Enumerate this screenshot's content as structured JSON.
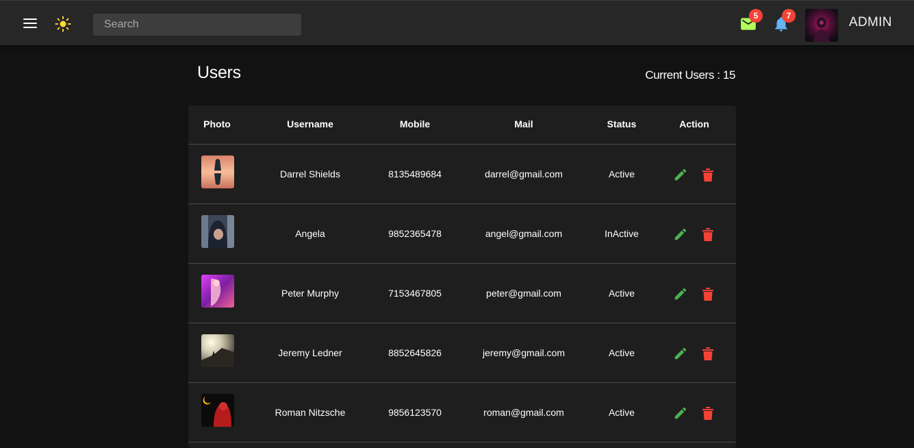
{
  "topbar": {
    "menu_icon": "menu-icon",
    "theme_icon": "sun-icon",
    "search_placeholder": "Search",
    "mail_icon": "mail-icon",
    "mail_count": "5",
    "bell_icon": "bell-icon",
    "bell_count": "7",
    "user_label": "ADMIN"
  },
  "colors": {
    "mail": "#b2ff59",
    "bell": "#64b5f6",
    "sun": "#fdd835",
    "badge": "#f44336",
    "edit": "#4caf50",
    "delete": "#f44336"
  },
  "page": {
    "title": "Users",
    "current_users": "Current Users : 15"
  },
  "table": {
    "headers": [
      "Photo",
      "Username",
      "Mobile",
      "Mail",
      "Status",
      "Action"
    ],
    "rows": [
      {
        "username": "Darrel Shields",
        "mobile": "8135489684",
        "mail": "darrel@gmail.com",
        "status": "Active"
      },
      {
        "username": "Angela",
        "mobile": "9852365478",
        "mail": "angel@gmail.com",
        "status": "InActive"
      },
      {
        "username": "Peter Murphy",
        "mobile": "7153467805",
        "mail": "peter@gmail.com",
        "status": "Active"
      },
      {
        "username": "Jeremy Ledner",
        "mobile": "8852645826",
        "mail": "jeremy@gmail.com",
        "status": "Active"
      },
      {
        "username": "Roman Nitzsche",
        "mobile": "9856123570",
        "mail": "roman@gmail.com",
        "status": "Active"
      }
    ]
  }
}
